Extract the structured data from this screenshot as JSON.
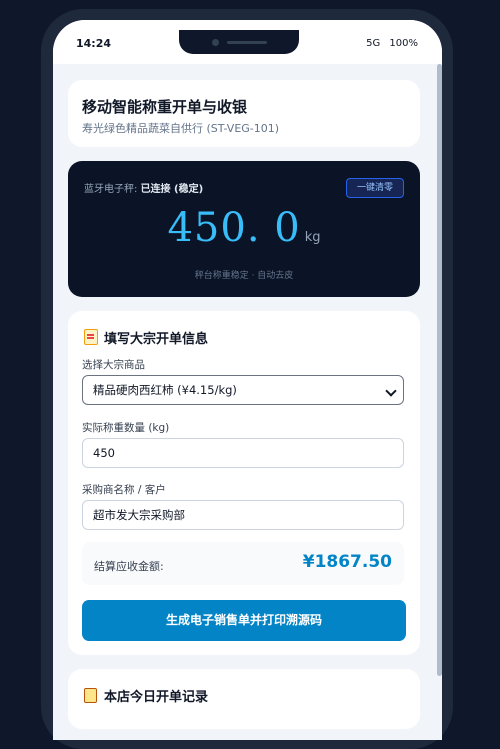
{
  "status_bar": {
    "time": "14:24",
    "network": "5G",
    "battery": "100%"
  },
  "header": {
    "title": "移动智能称重开单与收银",
    "subtitle": "寿光绿色精品蔬菜自供行 (ST-VEG-101)"
  },
  "scale": {
    "status_prefix": "蓝牙电子秤: ",
    "status_value": "已连接 (稳定)",
    "zero_label": "一键清零",
    "weight": "450. 0",
    "unit": "kg",
    "hint": "秤台称重稳定 · 自动去皮"
  },
  "form": {
    "title": "填写大宗开单信息",
    "product_label": "选择大宗商品",
    "product_value": "精品硬肉西红柿 (¥4.15/kg)",
    "weight_label": "实际称重数量 (kg)",
    "weight_value": "450",
    "buyer_label": "采购商名称 / 客户",
    "buyer_value": "超市发大宗采购部",
    "total_label": "结算应收金额:",
    "total_value": "¥1867.50",
    "submit_label": "生成电子销售单并打印溯源码"
  },
  "records": {
    "title": "本店今日开单记录"
  },
  "colors": {
    "accent": "#0284c7",
    "weight_display": "#38bdf8",
    "scale_bg": "#0b1427"
  }
}
